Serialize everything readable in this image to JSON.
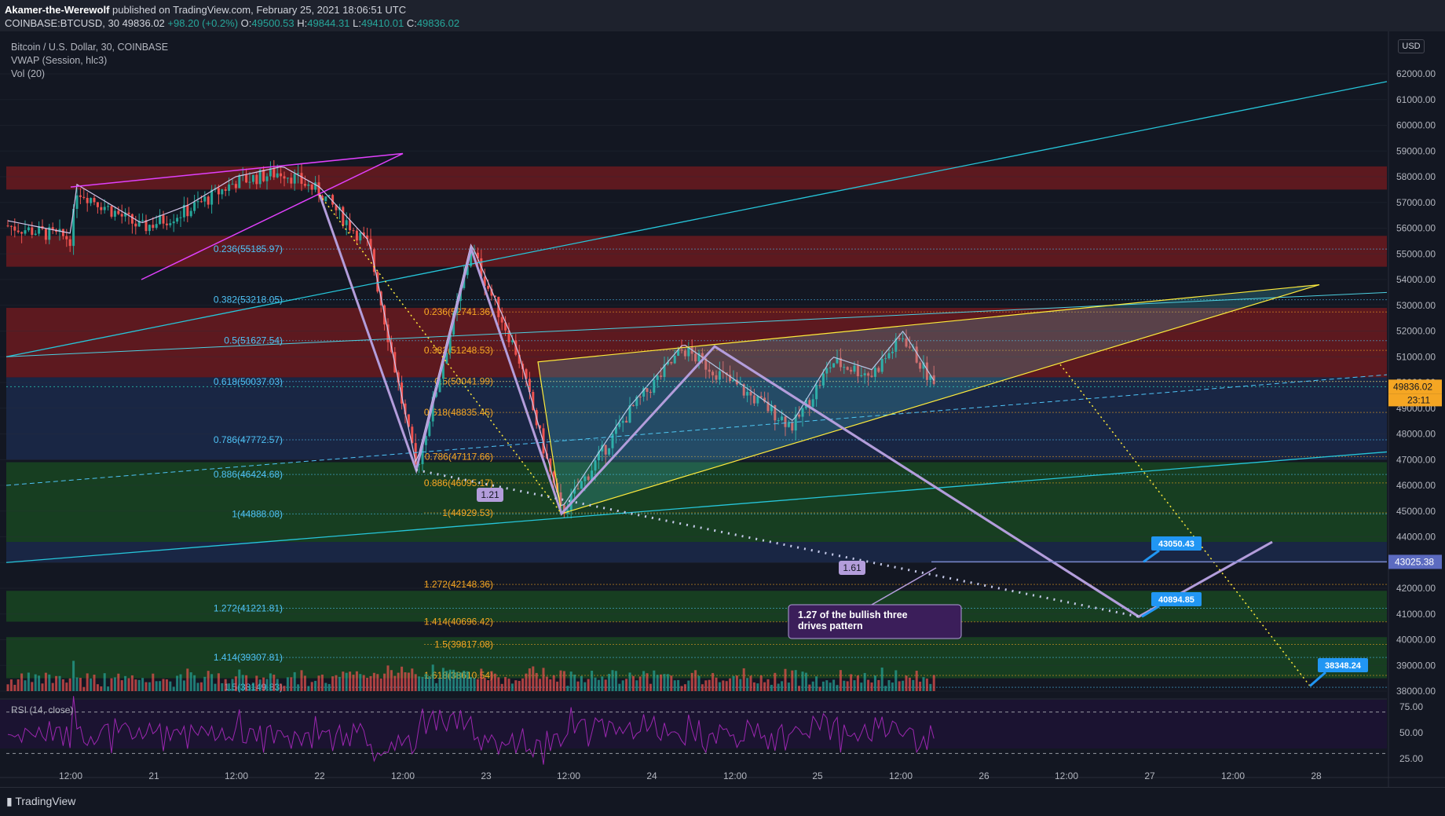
{
  "header": {
    "author": "Akamer-the-Werewolf",
    "published_text": "published on TradingView.com, February 25, 2021 18:06:51 UTC",
    "symbol": "COINBASE:BTCUSD, 30",
    "last_price": "49836.02",
    "change": "+98.20 (+0.2%)",
    "open_label": "O:",
    "open": "49500.53",
    "high_label": "H:",
    "high": "49844.31",
    "low_label": "L:",
    "low": "49410.01",
    "close_label": "C:",
    "close": "49836.02"
  },
  "legend": {
    "title": "Bitcoin / U.S. Dollar, 30, COINBASE",
    "vwap": "VWAP (Session, hlc3)",
    "vol": "Vol (20)",
    "rsi": "RSI (14, close)"
  },
  "price_axis": {
    "currency": "USD",
    "ticks": [
      "62000.00",
      "61000.00",
      "60000.00",
      "59000.00",
      "58000.00",
      "57000.00",
      "56000.00",
      "55000.00",
      "54000.00",
      "53000.00",
      "52000.00",
      "51000.00",
      "50000.00",
      "49000.00",
      "48000.00",
      "47000.00",
      "46000.00",
      "45000.00",
      "44000.00",
      "43000.00",
      "42000.00",
      "41000.00",
      "40000.00",
      "39000.00",
      "38000.00"
    ],
    "current_price_tag": "49836.02",
    "countdown_tag": "23:11",
    "line_price_tag": "43025.38"
  },
  "rsi_axis": {
    "ticks": [
      "75.00",
      "50.00",
      "25.00"
    ]
  },
  "time_axis": {
    "labels": [
      "12:00",
      "21",
      "12:00",
      "22",
      "12:00",
      "23",
      "12:00",
      "24",
      "12:00",
      "25",
      "12:00",
      "26",
      "12:00",
      "27",
      "12:00",
      "28"
    ]
  },
  "fib_left": [
    {
      "label": "0.236(55185.97)",
      "price": 55185.97
    },
    {
      "label": "0.382(53218.05)",
      "price": 53218.05
    },
    {
      "label": "0.5(51627.54)",
      "price": 51627.54
    },
    {
      "label": "0.618(50037.03)",
      "price": 50037.03
    },
    {
      "label": "0.786(47772.57)",
      "price": 47772.57
    },
    {
      "label": "0.886(46424.68)",
      "price": 46424.68
    },
    {
      "label": "1(44888.08)",
      "price": 44888.08
    },
    {
      "label": "1.272(41221.81)",
      "price": 41221.81
    },
    {
      "label": "1.414(39307.81)",
      "price": 39307.81
    },
    {
      "label": "1.5(38149.83)",
      "price": 38149.83
    }
  ],
  "fib_right": [
    {
      "label": "0.236(52741.36)",
      "price": 52741.36
    },
    {
      "label": "0.382(51248.53)",
      "price": 51248.53
    },
    {
      "label": "0.5(50041.99)",
      "price": 50041.99
    },
    {
      "label": "0.618(48835.45)",
      "price": 48835.45
    },
    {
      "label": "0.786(47117.66)",
      "price": 47117.66
    },
    {
      "label": "0.886(46095.17)",
      "price": 46095.17
    },
    {
      "label": "1(44929.53)",
      "price": 44929.53
    },
    {
      "label": "1.272(42148.36)",
      "price": 42148.36
    },
    {
      "label": "1.414(40696.42)",
      "price": 40696.42
    },
    {
      "label": "1.5(39817.08)",
      "price": 39817.08
    },
    {
      "label": "1.618(38610.54)",
      "price": 38610.54
    }
  ],
  "annotations": {
    "ratio_1": "1.21",
    "ratio_2": "1.61",
    "note_line1": "1.27 of the bullish three",
    "note_line2": "drives pattern",
    "target_1": "43050.43",
    "target_2": "40894.85",
    "target_3": "38348.24"
  },
  "colors": {
    "bull": "#26a69a",
    "bear": "#ef5350",
    "fib_cyan": "#4fc3f7",
    "fib_orange": "#f5a623",
    "pattern": "#b39ddb",
    "magenta": "#e040fb",
    "yellow": "#ffeb3b",
    "channel": "#26c6da",
    "callout": "#2196f3",
    "rsi": "#9c27b0"
  },
  "chart_data": {
    "type": "candlestick",
    "symbol": "BTCUSD",
    "interval": "30",
    "ylim": [
      37800,
      63000
    ],
    "key_points": [
      {
        "t": "2021-02-22 00:00",
        "price": 57500
      },
      {
        "t": "2021-02-22 12:00",
        "price": 46600
      },
      {
        "t": "2021-02-22 20:00",
        "price": 55200
      },
      {
        "t": "2021-02-23 08:00",
        "price": 44900
      },
      {
        "t": "2021-02-24 08:00",
        "price": 51400
      },
      {
        "t": "2021-02-25 06:00",
        "price": 52000
      },
      {
        "t": "2021-02-25 09:00",
        "price": 49836.02
      }
    ],
    "projection": [
      {
        "t": "2021-02-26 20:00",
        "price": 40894.85
      },
      {
        "t": "2021-02-27 20:00",
        "price": 43050.43
      },
      {
        "t": "2021-02-28 00:00",
        "price": 38348.24
      }
    ],
    "zones": [
      {
        "from": 57500,
        "to": 58400,
        "color": "red"
      },
      {
        "from": 54500,
        "to": 55700,
        "color": "red"
      },
      {
        "from": 50200,
        "to": 52900,
        "color": "red"
      },
      {
        "from": 43800,
        "to": 46900,
        "color": "green"
      },
      {
        "from": 40700,
        "to": 41900,
        "color": "green"
      },
      {
        "from": 38500,
        "to": 40100,
        "color": "green"
      }
    ],
    "rsi_levels": [
      70,
      30
    ]
  }
}
